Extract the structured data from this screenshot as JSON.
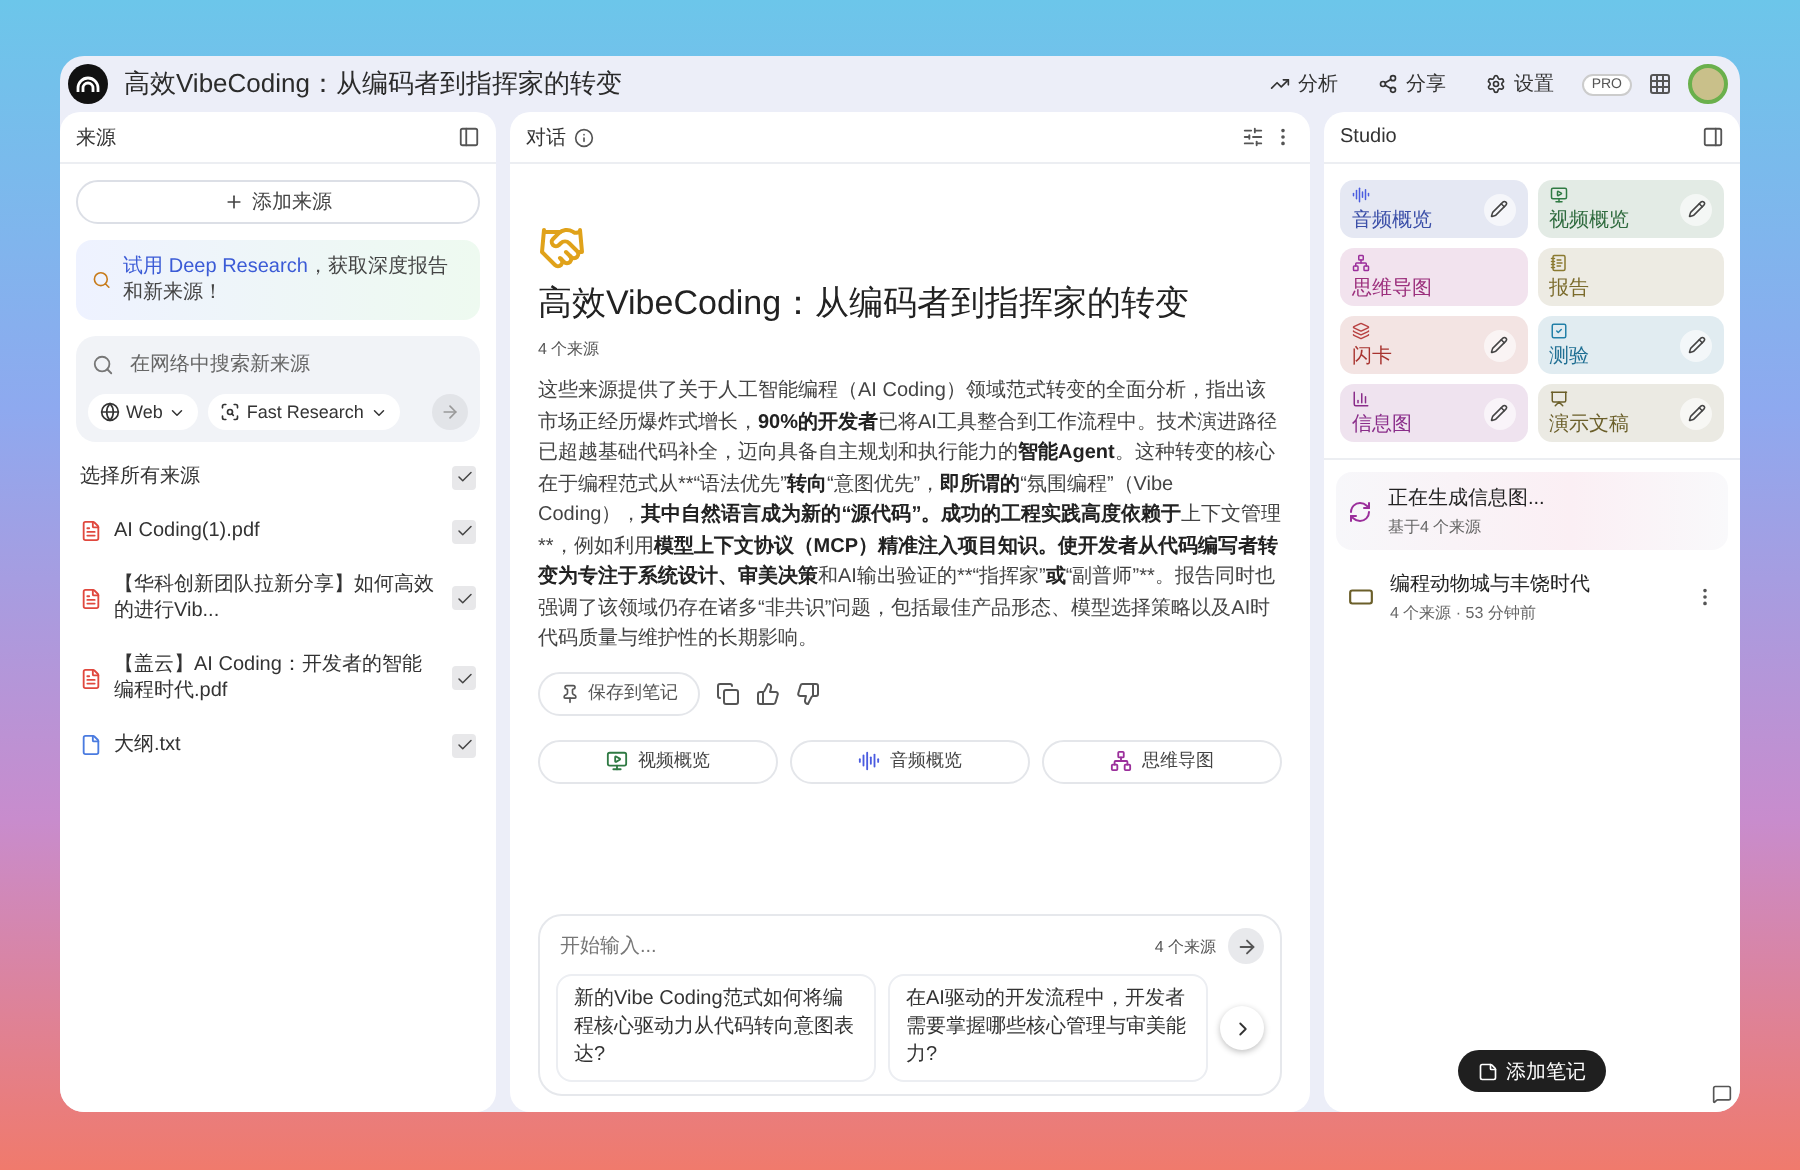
{
  "window": {
    "title": "高效VibeCoding：从编码者到指挥家的转变"
  },
  "toolbar": {
    "buttons": [
      {
        "kind": "analytics",
        "label": "分析"
      },
      {
        "kind": "share",
        "label": "分享"
      },
      {
        "kind": "settings",
        "label": "设置"
      }
    ],
    "badge": "PRO"
  },
  "sources": {
    "title": "来源",
    "add_button": "添加来源",
    "promo": {
      "link": "试用 Deep Research",
      "text": "，获取深度报告和新来源！"
    },
    "search": {
      "placeholder": "在网络中搜索新来源",
      "chips": [
        {
          "kind": "web",
          "label": "Web"
        },
        {
          "kind": "research",
          "label": "Fast Research"
        }
      ]
    },
    "select_all": {
      "label": "选择所有来源",
      "checked": true
    },
    "items": [
      {
        "kind": "pdf",
        "name": "AI Coding(1).pdf",
        "checked": true
      },
      {
        "kind": "pdf",
        "name": "【华科创新团队拉新分享】如何高效的进行Vib...",
        "checked": true
      },
      {
        "kind": "pdf",
        "name": "【盖云】AI Coding：开发者的智能编程时代.pdf",
        "checked": true
      },
      {
        "kind": "txt",
        "name": "大纲.txt",
        "checked": true
      }
    ]
  },
  "chat": {
    "title": "对话",
    "heading": "高效VibeCoding：从编码者到指挥家的转变",
    "source_count": "4 个来源",
    "summary": [
      {
        "text": "这些来源提供了关于人工智能编程（AI Coding）领域范式转变的全面分析，指出该市场正经历爆炸式增长，",
        "bold": false
      },
      {
        "text": "90%的开发者",
        "bold": true
      },
      {
        "text": "已将AI工具整合到工作流程中。技术演进路径已超越基础代码补全，迈向具备自主规划和执行能力的",
        "bold": false
      },
      {
        "text": "智能Agent",
        "bold": true
      },
      {
        "text": "。这种转变的核心在于编程范式从**“语法优先”",
        "bold": false
      },
      {
        "text": "转向",
        "bold": true
      },
      {
        "text": "“意图优先”，",
        "bold": false
      },
      {
        "text": "即所谓的",
        "bold": true
      },
      {
        "text": "“氛围编程”（Vibe Coding），",
        "bold": false
      },
      {
        "text": "其中自然语言成为新的“源代码”。成功的工程实践高度依赖于",
        "bold": true
      },
      {
        "text": "上下文管理**，例如利用",
        "bold": false
      },
      {
        "text": "模型上下文协议（MCP）精准注入项目知识。使开发者从代码编写者转变为专注于系统设计、审美决策",
        "bold": true
      },
      {
        "text": "和AI输出验证的**“指挥家”",
        "bold": false
      },
      {
        "text": "或",
        "bold": true
      },
      {
        "text": "“副普师”**。报告同时也强调了该领域仍存在诸多“非共识”问题，包括最佳产品形态、模型选择策略以及AI时代码质量与维护性的长期影响。",
        "bold": false
      }
    ],
    "save_button": "保存到笔记",
    "quick_actions": [
      {
        "kind": "video",
        "label": "视频概览"
      },
      {
        "kind": "audio",
        "label": "音频概览"
      },
      {
        "kind": "mindmap",
        "label": "思维导图"
      }
    ],
    "input": {
      "placeholder": "开始输入...",
      "source_count": "4 个来源"
    },
    "suggestions": [
      "新的Vibe Coding范式如何将编程核心驱动力从代码转向意图表达?",
      "在AI驱动的开发流程中，开发者需要掌握哪些核心管理与审美能力?"
    ]
  },
  "studio": {
    "title": "Studio",
    "tiles": [
      {
        "kind": "audio",
        "label": "音频概览",
        "color": "#3b4fa8",
        "editable": true
      },
      {
        "kind": "video",
        "label": "视频概览",
        "color": "#2f6b3e",
        "editable": true
      },
      {
        "kind": "mindmap",
        "label": "思维导图",
        "color": "#9b2f7c",
        "editable": false
      },
      {
        "kind": "report",
        "label": "报告",
        "color": "#7a6a2a",
        "editable": false
      },
      {
        "kind": "flashcard",
        "label": "闪卡",
        "color": "#a8332f",
        "editable": true
      },
      {
        "kind": "quiz",
        "label": "测验",
        "color": "#1f6f93",
        "editable": true
      },
      {
        "kind": "infographic",
        "label": "信息图",
        "color": "#8a2d8a",
        "editable": true
      },
      {
        "kind": "slides",
        "label": "演示文稿",
        "color": "#6b5f2a",
        "editable": true
      }
    ],
    "notes": [
      {
        "kind": "generating",
        "title": "正在生成信息图...",
        "meta": "基于4 个来源"
      },
      {
        "kind": "note",
        "title": "编程动物城与丰饶时代",
        "meta": "4 个来源 · 53 分钟前"
      }
    ],
    "add_note": "添加笔记"
  }
}
